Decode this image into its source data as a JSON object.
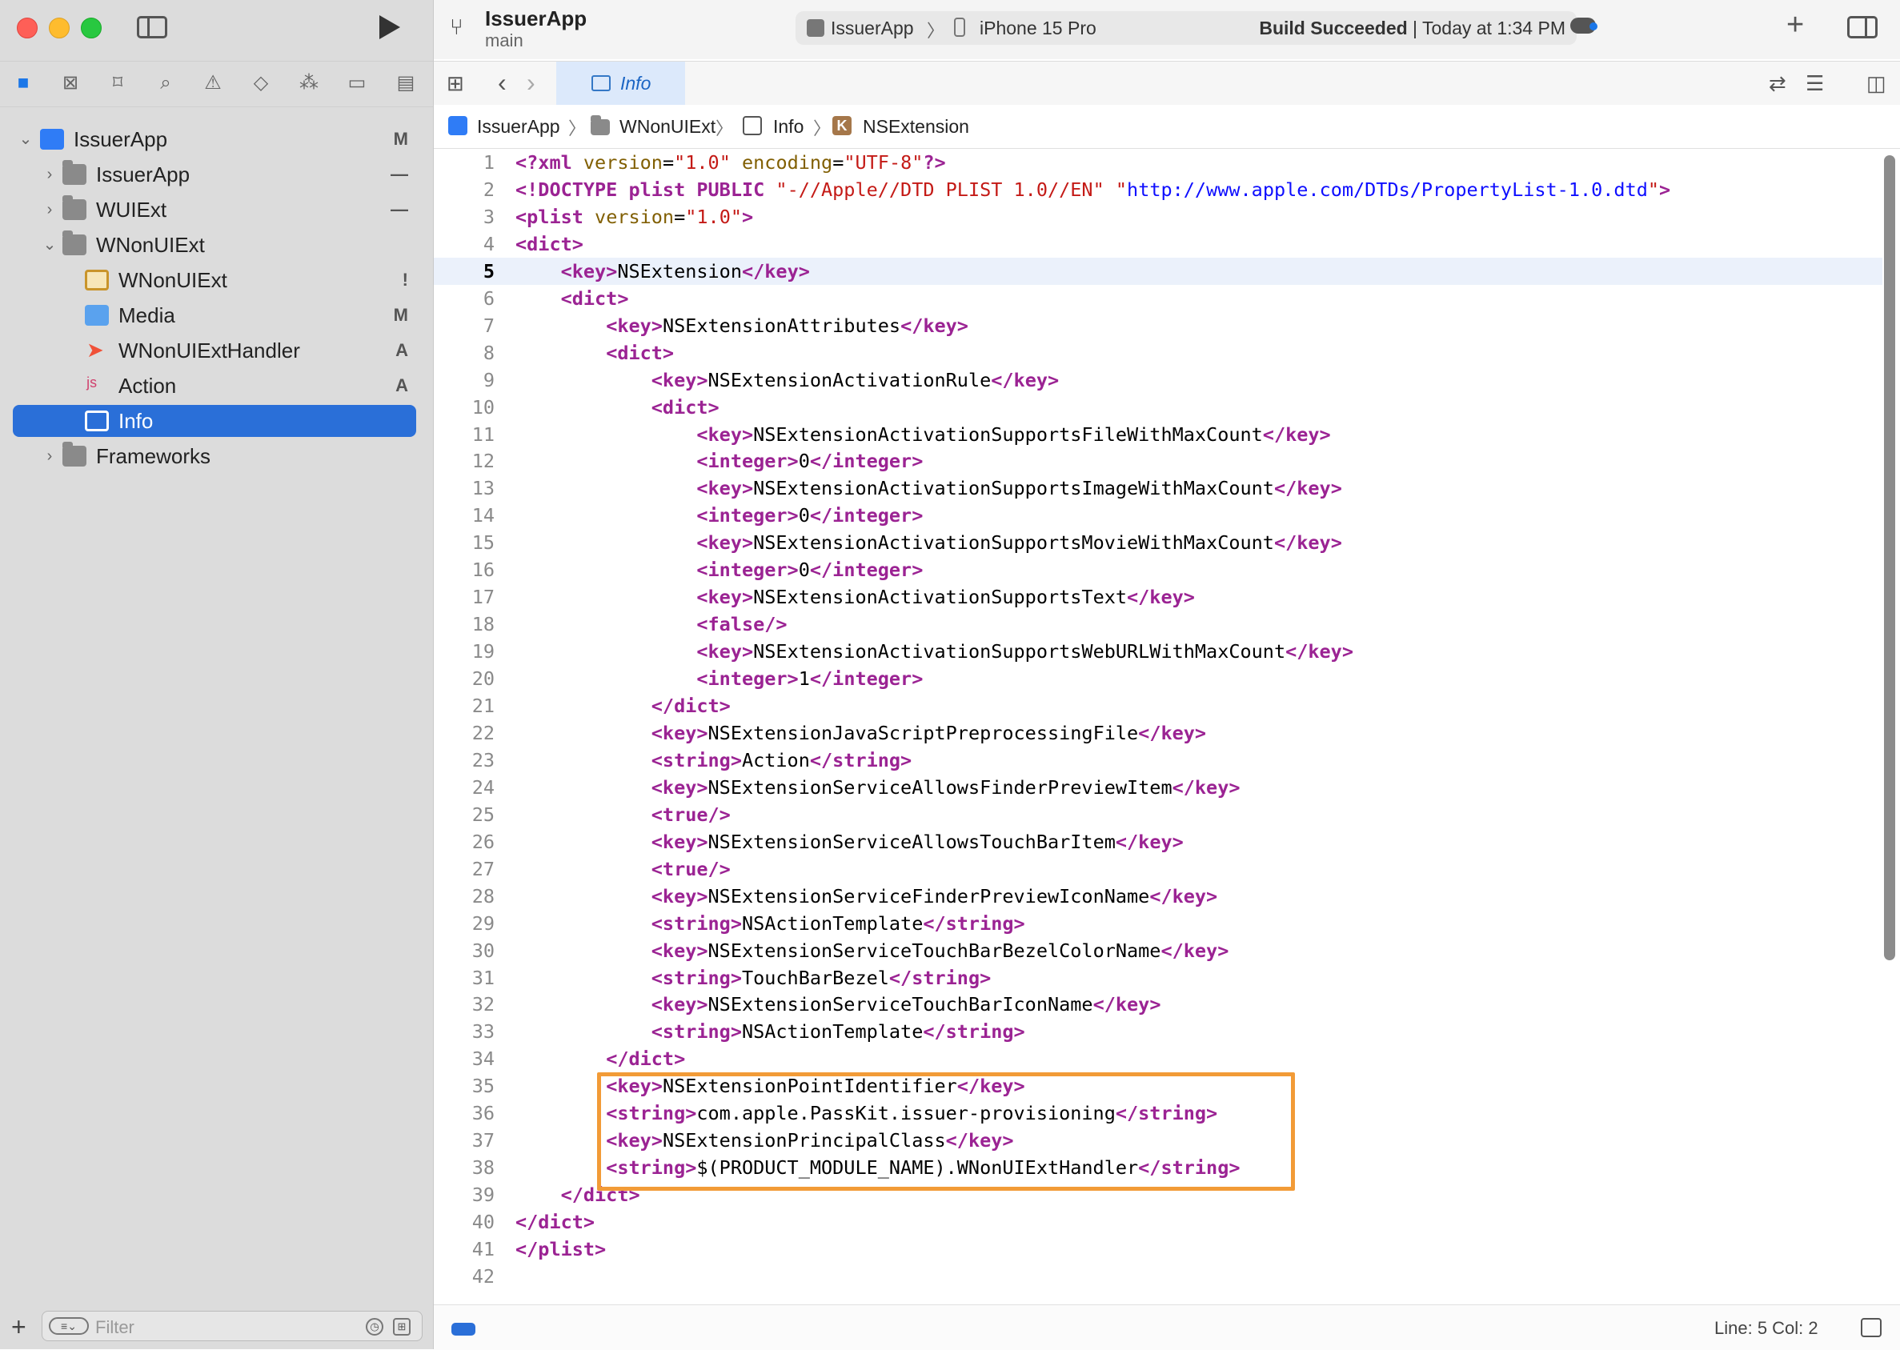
{
  "toolbar": {
    "project_title": "IssuerApp",
    "branch": "main",
    "activity": {
      "scheme": "IssuerApp",
      "device": "iPhone 15 Pro",
      "status_bold": "Build Succeeded",
      "status_rest": " | Today at 1:34 PM"
    }
  },
  "sidebar": {
    "items": [
      {
        "label": "IssuerApp",
        "badge": "M"
      },
      {
        "label": "IssuerApp",
        "badge": "—"
      },
      {
        "label": "WUIExt",
        "badge": "—"
      },
      {
        "label": "WNonUIExt",
        "badge": ""
      },
      {
        "label": "WNonUIExt",
        "badge": "!"
      },
      {
        "label": "Media",
        "badge": "M"
      },
      {
        "label": "WNonUIExtHandler",
        "badge": "A"
      },
      {
        "label": "Action",
        "badge": "A"
      },
      {
        "label": "Info",
        "badge": ""
      },
      {
        "label": "Frameworks",
        "badge": ""
      }
    ],
    "filter_placeholder": "Filter"
  },
  "tab": {
    "label": "Info"
  },
  "jumpbar": [
    "IssuerApp",
    "WNonUIExt",
    "Info",
    "NSExtension"
  ],
  "editor": {
    "current_line": 5,
    "line_numbers": [
      "1",
      "2",
      "3",
      "4",
      "5",
      "6",
      "7",
      "8",
      "9",
      "10",
      "11",
      "12",
      "13",
      "14",
      "15",
      "16",
      "17",
      "18",
      "19",
      "20",
      "21",
      "22",
      "23",
      "24",
      "25",
      "26",
      "27",
      "28",
      "29",
      "30",
      "31",
      "32",
      "33",
      "34",
      "35",
      "36",
      "37",
      "38",
      "39",
      "40",
      "41",
      "42"
    ]
  },
  "status": {
    "position": "Line: 5  Col: 2"
  },
  "colors": {
    "accent": "#2a6fd8",
    "tag": "#9b2393",
    "string": "#c41a16",
    "url": "#0e0eff",
    "highlight_box": "#f29b37"
  }
}
